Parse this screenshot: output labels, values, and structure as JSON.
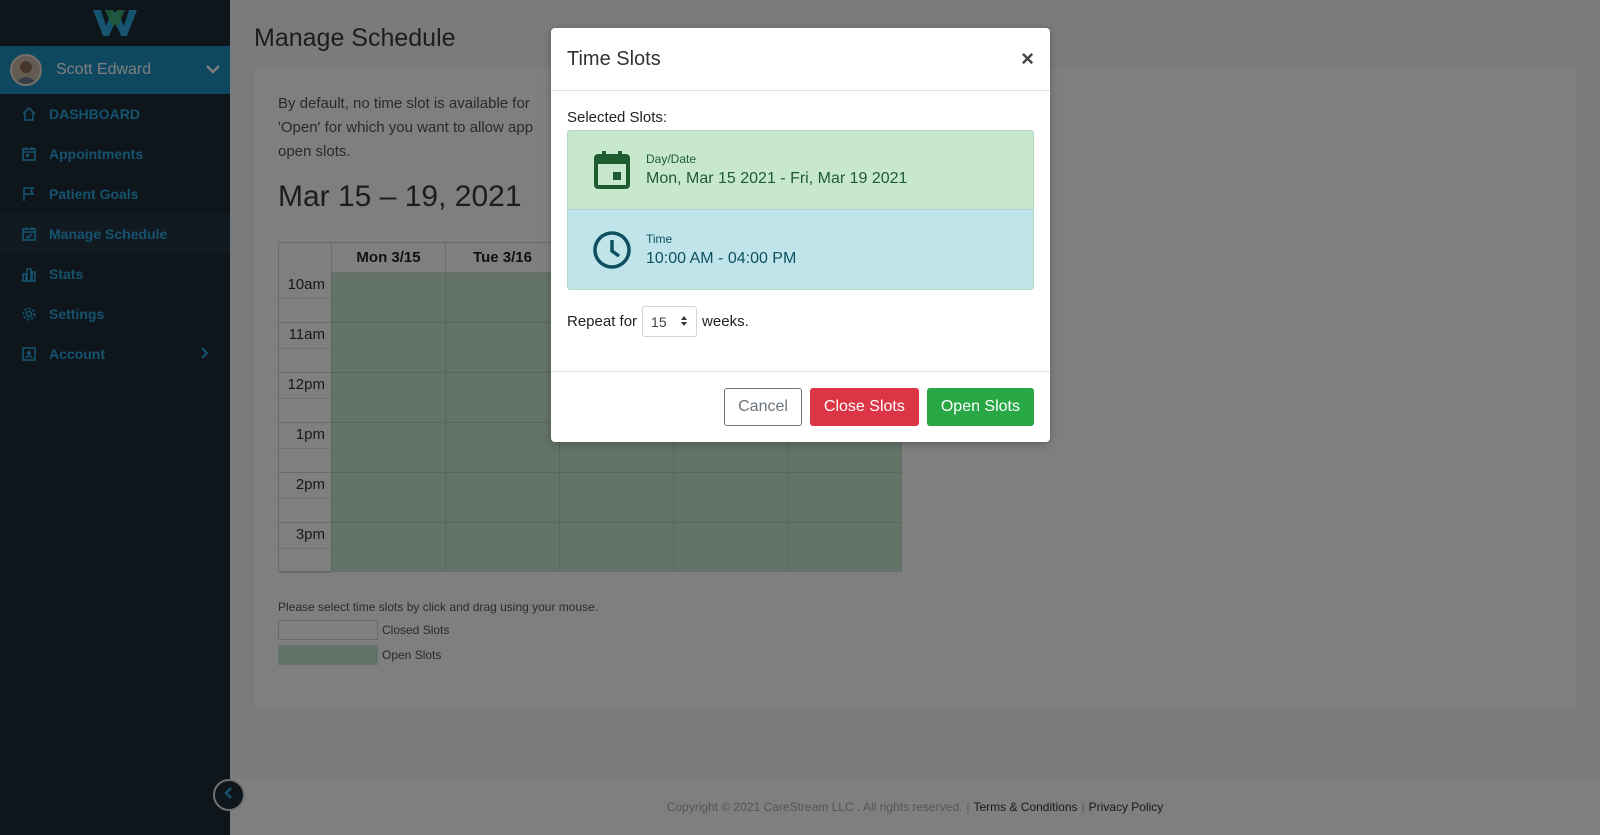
{
  "sidebar": {
    "user_name": "Scott Edward",
    "items": [
      {
        "label": "DASHBOARD",
        "icon": "home-icon"
      },
      {
        "label": "Appointments",
        "icon": "calendar-icon"
      },
      {
        "label": "Patient Goals",
        "icon": "flag-icon"
      },
      {
        "label": "Manage Schedule",
        "icon": "calendar-check-icon"
      },
      {
        "label": "Stats",
        "icon": "bar-chart-icon"
      },
      {
        "label": "Settings",
        "icon": "gear-icon"
      },
      {
        "label": "Account",
        "icon": "user-card-icon"
      }
    ]
  },
  "page": {
    "title": "Manage Schedule",
    "intro_line1": "By default, no time slot is available for",
    "intro_line2": "'Open' for which you want to allow app",
    "intro_line3": "open slots.",
    "week_title": "Mar 15 – 19, 2021",
    "days": [
      "Mon 3/15",
      "Tue 3/16",
      "",
      "",
      ""
    ],
    "times": [
      "10am",
      "11am",
      "12pm",
      "1pm",
      "2pm",
      "3pm"
    ],
    "hint": "Please select time slots by click and drag using your mouse.",
    "legend_closed": "Closed Slots",
    "legend_open": "Open Slots"
  },
  "footer": {
    "copyright": "Copyright © 2021 CareStream LLC . All rights reserved.",
    "terms": "Terms & Conditions",
    "privacy": "Privacy Policy"
  },
  "modal": {
    "title": "Time Slots",
    "close_symbol": "×",
    "selected_label": "Selected Slots:",
    "date_label": "Day/Date",
    "date_value": "Mon, Mar 15 2021 - Fri, Mar 19 2021",
    "time_label": "Time",
    "time_value": "10:00 AM - 04:00 PM",
    "repeat_prefix": "Repeat for",
    "repeat_value": "15",
    "repeat_suffix": "weeks.",
    "cancel_label": "Cancel",
    "close_slots_label": "Close Slots",
    "open_slots_label": "Open Slots"
  },
  "colors": {
    "sidebar_bg": "#1c2a36",
    "accent": "#1a8fc1",
    "open_slot": "#c7e7d0",
    "danger": "#dc3545",
    "success": "#28a745"
  }
}
